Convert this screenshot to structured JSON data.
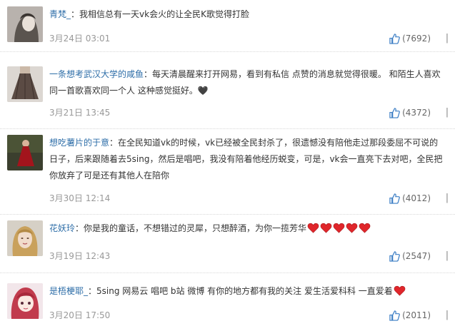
{
  "comments": [
    {
      "user": "青梵_",
      "sep": "：",
      "text": "我相信总有一天vk会火的让全民K歌觉得打脸",
      "date": "3月24日 03:01",
      "likes": "(7692)",
      "hearts": 0,
      "avatar_icon": "avatar-portrait-icon"
    },
    {
      "user": "一条想考武汉大学的咸鱼",
      "sep": "：",
      "text": "每天清晨醒来打开网易，看到有私信 点赞的消息就觉得很暖。 和陌生人喜欢同一首歌喜欢同一个人 这种感觉挺好。🖤",
      "date": "3月21日 13:45",
      "likes": "(4372)",
      "hearts": 0,
      "avatar_icon": "avatar-skirt-icon"
    },
    {
      "user": "想吃薯片的于意",
      "sep": "：",
      "text": "在全民知道vk的时候，vk已经被全民封杀了，很遗憾没有陪他走过那段委屈不可说的日子，后来跟随着去5sing，然后是唱吧，我没有陪着他经历蜕变，可是，vk会一直亮下去对吧，全民把你放弃了可是还有其他人在陪你",
      "date": "3月30日 12:14",
      "likes": "(4012)",
      "hearts": 0,
      "avatar_icon": "avatar-red-dress-icon"
    },
    {
      "user": "花妖玲",
      "sep": "：",
      "text": "你是我的童话，不想错过的灵犀，只想醉酒，为你一揽芳华",
      "date": "3月19日 12:43",
      "likes": "(2547)",
      "hearts": 5,
      "avatar_icon": "avatar-blonde-woman-icon"
    },
    {
      "user": "是梧梗耶_",
      "sep": "：",
      "text": "5sing 网易云 唱吧 b站 微博 有你的地方都有我的关注 爱生活爱科科 一直爱着",
      "date": "3月20日 17:50",
      "likes": "(2011)",
      "hearts": 1,
      "avatar_icon": "avatar-anime-girl-icon"
    }
  ],
  "more_glyph": "|",
  "colors": {
    "username": "#2e6ea8",
    "meta": "#999999",
    "like_icon": "#3b7dc4",
    "heart": "#e0262b"
  }
}
